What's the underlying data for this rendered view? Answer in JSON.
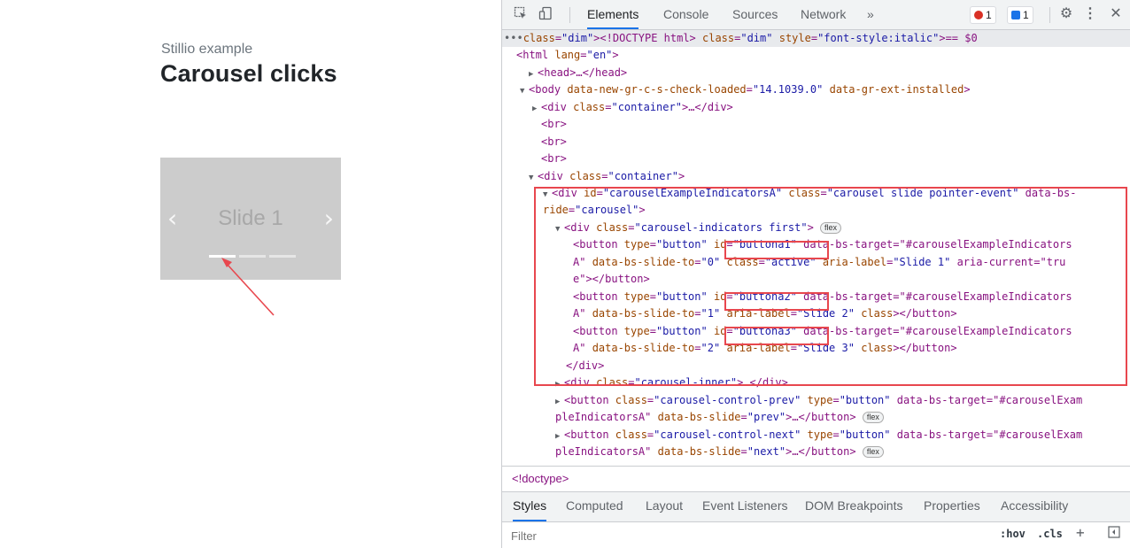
{
  "page": {
    "subtitle": "Stillio example",
    "title": "Carousel clicks",
    "carousel": {
      "slide_text": "Slide 1",
      "prev_glyph": "‹",
      "next_glyph": "›",
      "indicator_count": 3,
      "active_index": 0
    }
  },
  "devtools": {
    "tabs": [
      {
        "label": "Elements",
        "active": true
      },
      {
        "label": "Console",
        "active": false
      },
      {
        "label": "Sources",
        "active": false
      },
      {
        "label": "Network",
        "active": false
      }
    ],
    "more_tabs_glyph": "»",
    "error_count": "1",
    "message_count": "1",
    "colors": {
      "accent": "#1a73e8",
      "error": "#d93025",
      "highlight": "#e8474e",
      "tag": "#881280",
      "attr": "#994500",
      "value": "#1a1aa6"
    },
    "dom_lines": [
      {
        "t": "•••<!DOCTYPE html> == $0"
      },
      {
        "t": "<html lang=\"en\">"
      },
      {
        "t": "▶<head>…</head>"
      },
      {
        "t": "▼<body data-new-gr-c-s-check-loaded=\"14.1039.0\" data-gr-ext-installed>"
      },
      {
        "t": "▶<div class=\"container\">…</div>"
      },
      {
        "t": "<br>"
      },
      {
        "t": "<br>"
      },
      {
        "t": "<br>"
      },
      {
        "t": "▼<div class=\"container\">"
      },
      {
        "t": "▼<div id=\"carouselExampleIndicatorsA\" class=\"carousel slide pointer-event\" data-bs-"
      },
      {
        "t": "ride=\"carousel\">"
      },
      {
        "t": "▼<div class=\"carousel-indicators first\">"
      },
      {
        "t": "<button type=\"button\" id=\"buttona1\" data-bs-target=\"#carouselExampleIndicators"
      },
      {
        "t": "A\" data-bs-slide-to=\"0\" class=\"active\" aria-label=\"Slide 1\" aria-current=\"tru"
      },
      {
        "t": "e\"></button>"
      },
      {
        "t": "<button type=\"button\" id=\"buttona2\" data-bs-target=\"#carouselExampleIndicators"
      },
      {
        "t": "A\" data-bs-slide-to=\"1\" aria-label=\"Slide 2\" class></button>"
      },
      {
        "t": "<button type=\"button\" id=\"buttona3\" data-bs-target=\"#carouselExampleIndicators"
      },
      {
        "t": "A\" data-bs-slide-to=\"2\" aria-label=\"Slide 3\" class></button>"
      },
      {
        "t": "</div>"
      },
      {
        "t": "▶<div class=\"carousel-inner\">…</div>"
      },
      {
        "t": "▶<button class=\"carousel-control-prev\" type=\"button\" data-bs-target=\"#carouselExam"
      },
      {
        "t": "pleIndicatorsA\" data-bs-slide=\"prev\">…</button>"
      },
      {
        "t": "▶<button class=\"carousel-control-next\" type=\"button\" data-bs-target=\"#carouselExam"
      },
      {
        "t": "pleIndicatorsA\" data-bs-slide=\"next\">…</button>"
      }
    ],
    "flex_pill": "flex",
    "breadcrumb": "<!doctype>",
    "subtabs": [
      {
        "label": "Styles",
        "active": true
      },
      {
        "label": "Computed",
        "active": false
      },
      {
        "label": "Layout",
        "active": false
      },
      {
        "label": "Event Listeners",
        "active": false
      },
      {
        "label": "DOM Breakpoints",
        "active": false
      },
      {
        "label": "Properties",
        "active": false
      },
      {
        "label": "Accessibility",
        "active": false
      }
    ],
    "filter_placeholder": "Filter",
    "hov_label": ":hov",
    "cls_label": ".cls",
    "plus_glyph": "+"
  }
}
